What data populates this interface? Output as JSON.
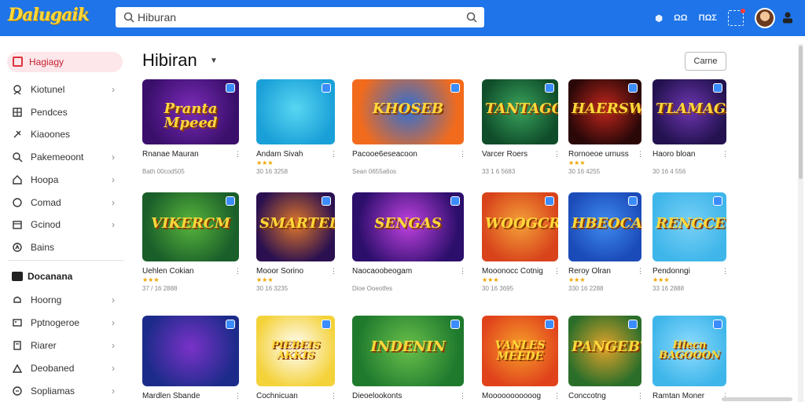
{
  "app": {
    "logo_text": "Dalugaik"
  },
  "search": {
    "value": "Hiburan"
  },
  "topbar": {
    "items": [
      "⬢",
      "ΩΩ",
      "ΠΩΣ"
    ]
  },
  "sidebar": {
    "active_label": "Hagiagy",
    "items": [
      {
        "label": "Kiotunel",
        "icon": "location-icon",
        "chevron": true
      },
      {
        "label": "Pendces",
        "icon": "grid-icon",
        "chevron": false
      },
      {
        "label": "Kiaoones",
        "icon": "pin-icon",
        "chevron": false
      },
      {
        "label": "Pakemeoont",
        "icon": "search-icon",
        "chevron": true
      },
      {
        "label": "Hoopa",
        "icon": "home-icon",
        "chevron": true
      },
      {
        "label": "Comad",
        "icon": "chat-icon",
        "chevron": true
      },
      {
        "label": "Gcinod",
        "icon": "calendar-icon",
        "chevron": true
      },
      {
        "label": "Bains",
        "icon": "compass-icon",
        "chevron": false
      }
    ],
    "section_label": "Docanana",
    "section_items": [
      {
        "label": "Hoorng",
        "icon": "bell-icon",
        "chevron": true
      },
      {
        "label": "Pptnogeroe",
        "icon": "image-icon",
        "chevron": true
      },
      {
        "label": "Riarer",
        "icon": "book-icon",
        "chevron": true
      },
      {
        "label": "Deobaned",
        "icon": "user-icon",
        "chevron": true
      },
      {
        "label": "Sopliamas",
        "icon": "message-icon",
        "chevron": true
      }
    ]
  },
  "main": {
    "title": "Hibiran",
    "button_label": "Carne",
    "games": [
      {
        "name": "Rnanae Mauran",
        "stars": "",
        "meta": "Bath 00cod505",
        "art": "Pranta Mpeed",
        "colors": [
          "#3a0f6b",
          "#7a2bb8"
        ]
      },
      {
        "name": "Andam Sivah",
        "stars": "★★★",
        "meta": "30 16 3258",
        "art": "",
        "colors": [
          "#1aa0d8",
          "#58d6f2"
        ]
      },
      {
        "name": "Pacooe6eseacoon",
        "stars": "",
        "meta": "Sean 0655a6os",
        "art": "KHOSEB",
        "colors": [
          "#f26b1d",
          "#2d6fd6"
        ]
      },
      {
        "name": "Varcer Roers",
        "stars": "",
        "meta": "33 1 6 5683",
        "art": "TANTAGON",
        "colors": [
          "#0f4d2a",
          "#3aa35c"
        ]
      },
      {
        "name": "Rornoeoe urnuss",
        "stars": "★★★",
        "meta": "30 16 4255",
        "art": "HAERSWAS",
        "colors": [
          "#2a0808",
          "#c2261d"
        ]
      },
      {
        "name": "Haoro bloan",
        "stars": "",
        "meta": "30 16 4 556",
        "art": "TLAMAGD",
        "colors": [
          "#23124f",
          "#6d36b0"
        ]
      },
      {
        "name": "Uehlen Cokian",
        "stars": "★★★",
        "meta": "37 / 16 2888",
        "art": "VIKERCM",
        "colors": [
          "#1a5e2a",
          "#57b53b"
        ]
      },
      {
        "name": "Mooor Sorino",
        "stars": "★★★",
        "meta": "30 16 3235",
        "art": "SMARTEDO",
        "colors": [
          "#2a1050",
          "#e0772a"
        ]
      },
      {
        "name": "Naocaoobeogam",
        "stars": "",
        "meta": "Dioe Ooeotfes",
        "art": "SENGAS",
        "colors": [
          "#2c0e6b",
          "#c042e0"
        ]
      },
      {
        "name": "Mooonocc Cotnig",
        "stars": "★★★",
        "meta": "30 16 3695",
        "art": "WOOGCRON",
        "colors": [
          "#d8431b",
          "#f4a23a"
        ]
      },
      {
        "name": "Reroy Olran",
        "stars": "★★★",
        "meta": "330 16 2288",
        "art": "HBEOCAN",
        "colors": [
          "#1b4bb8",
          "#3f8af0"
        ]
      },
      {
        "name": "Pendonngi",
        "stars": "★★★",
        "meta": "33 16 2888",
        "art": "RENGCE",
        "colors": [
          "#3fb6ea",
          "#78d0f6"
        ]
      },
      {
        "name": "Mardlen Sbande",
        "stars": "",
        "meta": "",
        "art": "",
        "colors": [
          "#1c2b8a",
          "#7a32c8"
        ]
      },
      {
        "name": "Cochnicuan",
        "stars": "",
        "meta": "",
        "art": "PIEBEIS AKKIS",
        "colors": [
          "#f4d23a",
          "#ffffff"
        ]
      },
      {
        "name": "Dieoelookonts",
        "stars": "",
        "meta": "",
        "art": "INDENIN",
        "colors": [
          "#1f7a2e",
          "#69c04a"
        ]
      },
      {
        "name": "Mooooooooooog",
        "stars": "",
        "meta": "",
        "art": "VANLES MEEDE",
        "colors": [
          "#e0431c",
          "#f7a02a"
        ]
      },
      {
        "name": "Conccotng",
        "stars": "",
        "meta": "",
        "art": "PANGEBT",
        "colors": [
          "#2a6e2a",
          "#e4a42a"
        ]
      },
      {
        "name": "Ramtan Moner",
        "stars": "",
        "meta": "",
        "art": "Hlecn BAGOOON",
        "colors": [
          "#3fb6ea",
          "#8fdcff"
        ]
      }
    ]
  }
}
